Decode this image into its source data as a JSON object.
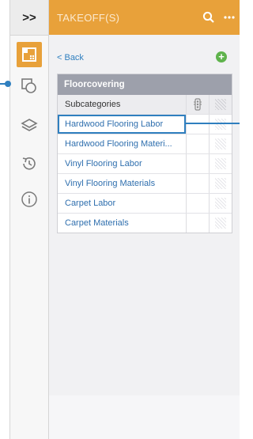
{
  "rail": {
    "expand_label": ">>",
    "icons": [
      "ruler-grid-icon",
      "layers-stack-icon",
      "stack-icon",
      "history-icon",
      "info-icon"
    ]
  },
  "header": {
    "title": "TAKEOFF(S)",
    "search_icon": "search-icon",
    "more_icon": "more-icon"
  },
  "nav": {
    "back_label": "< Back",
    "add_icon": "add-icon"
  },
  "table": {
    "title": "Floorcovering",
    "header_label": "Subcategories",
    "rows": [
      "Hardwood Flooring Labor",
      "Hardwood Flooring Materi...",
      "Vinyl Flooring Labor",
      "Vinyl Flooring Materials",
      "Carpet Labor",
      "Carpet Materials"
    ],
    "selected_index": 0
  },
  "colors": {
    "accent": "#e8a13a",
    "link": "#2f7fbf",
    "table_header": "#9da0ab",
    "add_green": "#5fb34c"
  }
}
